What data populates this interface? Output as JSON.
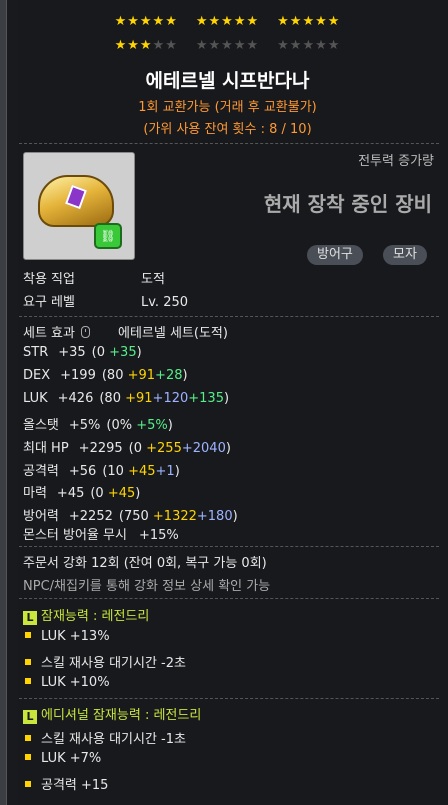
{
  "stars": {
    "filled": 3,
    "total": 15
  },
  "item": {
    "name": "에테르넬 시프반다나",
    "exchange": "1회 교환가능 (거래 후 교환불가)",
    "scissors": "(가위 사용 잔여 횟수 : 8 / 10)",
    "combat_label": "전투력 증가량",
    "equipped_text": "현재 장착 중인 장비",
    "tags": [
      "방어구",
      "모자"
    ]
  },
  "req": {
    "job_label": "착용 직업",
    "job_value": "도적",
    "level_label": "요구 레벨",
    "level_value": "Lv. 250"
  },
  "set": {
    "label": "세트 효과",
    "value": "에테르넬 세트(도적)"
  },
  "stats": [
    {
      "label": "STR",
      "total": "+35",
      "base": "0",
      "parts": [
        {
          "text": "+35",
          "color": "green"
        }
      ]
    },
    {
      "label": "DEX",
      "total": "+199",
      "base": "80",
      "parts": [
        {
          "text": "+91",
          "color": "yellow"
        },
        {
          "text": "+28",
          "color": "green"
        }
      ]
    },
    {
      "label": "LUK",
      "total": "+426",
      "base": "80",
      "parts": [
        {
          "text": "+91",
          "color": "yellow"
        },
        {
          "text": "+120",
          "color": "blue"
        },
        {
          "text": "+135",
          "color": "green"
        }
      ]
    },
    {
      "label": "올스탯",
      "total": "+5%",
      "base": "0%",
      "parts": [
        {
          "text": "+5%",
          "color": "green"
        }
      ]
    },
    {
      "label": "최대 HP",
      "total": "+2295",
      "base": "0",
      "parts": [
        {
          "text": "+255",
          "color": "yellow"
        },
        {
          "text": "+2040",
          "color": "blue"
        }
      ]
    },
    {
      "label": "공격력",
      "total": "+56",
      "base": "10",
      "parts": [
        {
          "text": "+45",
          "color": "yellow"
        },
        {
          "text": "+1",
          "color": "blue"
        }
      ]
    },
    {
      "label": "마력",
      "total": "+45",
      "base": "0",
      "parts": [
        {
          "text": "+45",
          "color": "yellow"
        }
      ]
    },
    {
      "label": "방어력",
      "total": "+2252",
      "base": "750",
      "parts": [
        {
          "text": "+1322",
          "color": "yellow"
        },
        {
          "text": "+180",
          "color": "blue"
        }
      ]
    }
  ],
  "ignore_def": {
    "label": "몬스터 방어율 무시",
    "value": "+15%"
  },
  "scroll": {
    "text": "주문서 강화 12회 (잔여 0회, 복구 가능 0회)",
    "hint": "NPC/채집키를 통해 강화 정보 상세 확인 가능"
  },
  "potential": {
    "badge": "L",
    "title": "잠재능력 : 레전드리",
    "lines": [
      "LUK +13%",
      "스킬 재사용 대기시간 -2초",
      "LUK +10%"
    ]
  },
  "additional": {
    "badge": "L",
    "title": "에디셔널 잠재능력 : 레전드리",
    "lines": [
      "스킬 재사용 대기시간 -1초",
      "LUK +7%",
      "공격력 +15"
    ]
  },
  "colors": {
    "star": "#ffd400",
    "orange": "#ff9933",
    "potential": "#c8e63c",
    "green": "#55ee88",
    "blue": "#9fb4ff"
  }
}
